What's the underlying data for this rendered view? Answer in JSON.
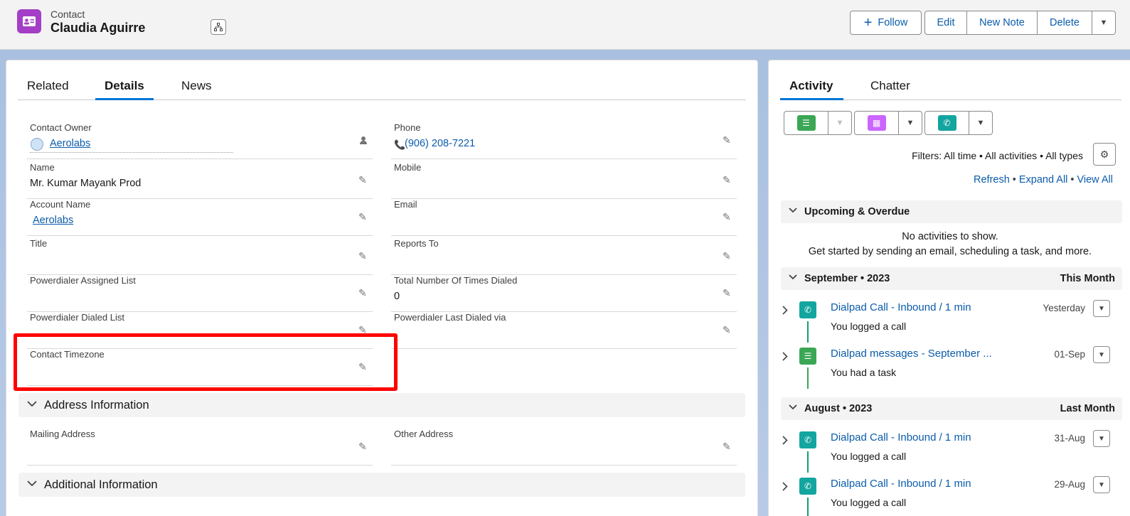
{
  "header": {
    "object_type": "Contact",
    "record_name": "Claudia Aguirre",
    "buttons": {
      "follow": "Follow",
      "edit": "Edit",
      "new_note": "New Note",
      "delete": "Delete"
    }
  },
  "details": {
    "tabs": [
      "Related",
      "Details",
      "News"
    ],
    "fields": {
      "contact_owner": {
        "label": "Contact Owner",
        "value": "Aerolabs"
      },
      "phone": {
        "label": "Phone",
        "value": "(906) 208-7221"
      },
      "name": {
        "label": "Name",
        "value": "Mr. Kumar Mayank Prod"
      },
      "mobile": {
        "label": "Mobile",
        "value": ""
      },
      "account_name": {
        "label": "Account Name",
        "value": "Aerolabs"
      },
      "email": {
        "label": "Email",
        "value": ""
      },
      "title": {
        "label": "Title",
        "value": ""
      },
      "reports_to": {
        "label": "Reports To",
        "value": ""
      },
      "pd_assigned_list": {
        "label": "Powerdialer Assigned List",
        "value": ""
      },
      "total_times_dialed": {
        "label": "Total Number Of Times Dialed",
        "value": "0"
      },
      "pd_dialed_list": {
        "label": "Powerdialer Dialed List",
        "value": ""
      },
      "pd_last_dialed_via": {
        "label": "Powerdialer Last Dialed via",
        "value": ""
      },
      "contact_timezone": {
        "label": "Contact Timezone",
        "value": ""
      },
      "mailing_address": {
        "label": "Mailing Address",
        "value": ""
      },
      "other_address": {
        "label": "Other Address",
        "value": ""
      }
    },
    "sections": {
      "address": "Address Information",
      "additional": "Additional Information"
    }
  },
  "activity": {
    "tabs": [
      "Activity",
      "Chatter"
    ],
    "filters": "Filters: All time • All activities • All types",
    "links": {
      "refresh": "Refresh",
      "expand_all": "Expand All",
      "view_all": "View All"
    },
    "upcoming": {
      "title": "Upcoming & Overdue",
      "empty_line1": "No activities to show.",
      "empty_line2": "Get started by sending an email, scheduling a task, and more."
    },
    "groups": [
      {
        "title": "September • 2023",
        "period": "This Month",
        "items": [
          {
            "subject": "Dialpad Call - Inbound / 1 min",
            "desc": "You logged a call",
            "date": "Yesterday",
            "icon": "call-icon"
          },
          {
            "subject": "Dialpad messages - September ...",
            "desc": "You had a task",
            "date": "01-Sep",
            "icon": "task-icon"
          }
        ]
      },
      {
        "title": "August • 2023",
        "period": "Last Month",
        "items": [
          {
            "subject": "Dialpad Call - Inbound / 1 min",
            "desc": "You logged a call",
            "date": "31-Aug",
            "icon": "call-icon"
          },
          {
            "subject": "Dialpad Call - Inbound / 1 min",
            "desc": "You logged a call",
            "date": "29-Aug",
            "icon": "call-icon"
          }
        ]
      }
    ]
  },
  "colors": {
    "brand_blue": "#0176d3",
    "link_blue": "#0b5cab",
    "contact_purple": "#a43ec7",
    "task_green": "#3ba755",
    "event_purple": "#cb65ff",
    "call_teal": "#13a5a0",
    "highlight_red": "#ff0000"
  }
}
